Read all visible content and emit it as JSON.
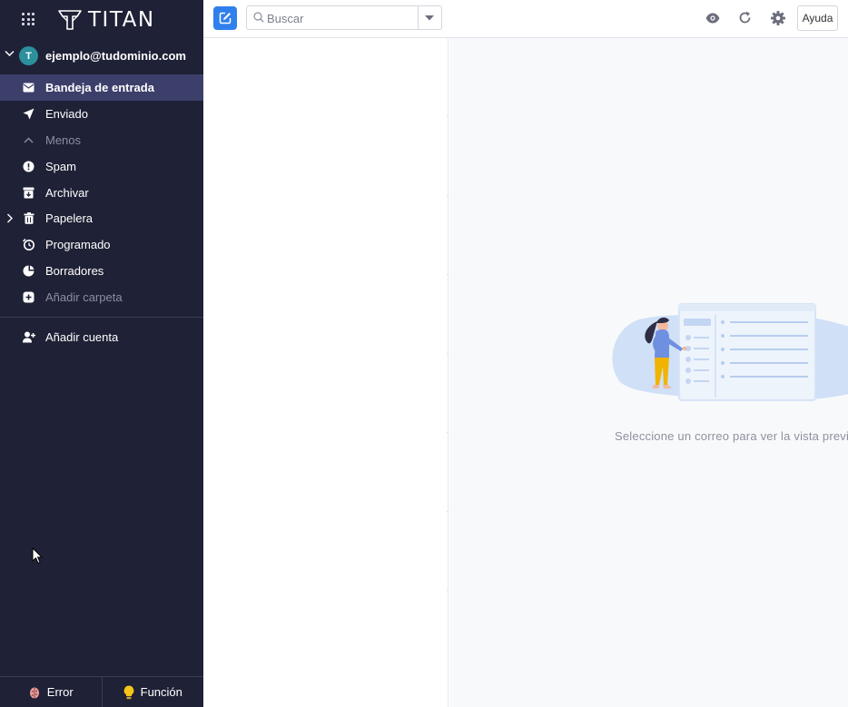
{
  "brand": {
    "name": "TITAN"
  },
  "account": {
    "initial": "T",
    "email": "ejemplo@tudominio.com"
  },
  "folders": [
    {
      "label": "Bandeja de entrada",
      "icon": "inbox-icon",
      "active": true
    },
    {
      "label": "Enviado",
      "icon": "send-icon"
    },
    {
      "label": "Menos",
      "icon": "chevron-up-icon"
    },
    {
      "label": "Spam",
      "icon": "spam-icon"
    },
    {
      "label": "Archivar",
      "icon": "archive-icon"
    },
    {
      "label": "Papelera",
      "icon": "trash-icon"
    },
    {
      "label": "Programado",
      "icon": "scheduled-icon"
    },
    {
      "label": "Borradores",
      "icon": "drafts-icon"
    },
    {
      "label": "Añadir carpeta",
      "icon": "add-folder-icon"
    }
  ],
  "add_account": {
    "label": "Añadir cuenta"
  },
  "bottom": {
    "error_label": "Error",
    "feature_label": "Función"
  },
  "search": {
    "placeholder": "Buscar",
    "value": ""
  },
  "toolbar": {
    "help_label": "Ayuda"
  },
  "preview": {
    "empty_message": "Seleccione un correo para ver la vista previ"
  },
  "colors": {
    "sidebar_bg": "#1f2136",
    "active_bg": "#3d3f6b",
    "accent": "#2f80ed",
    "avatar": "#2b8f9c"
  }
}
